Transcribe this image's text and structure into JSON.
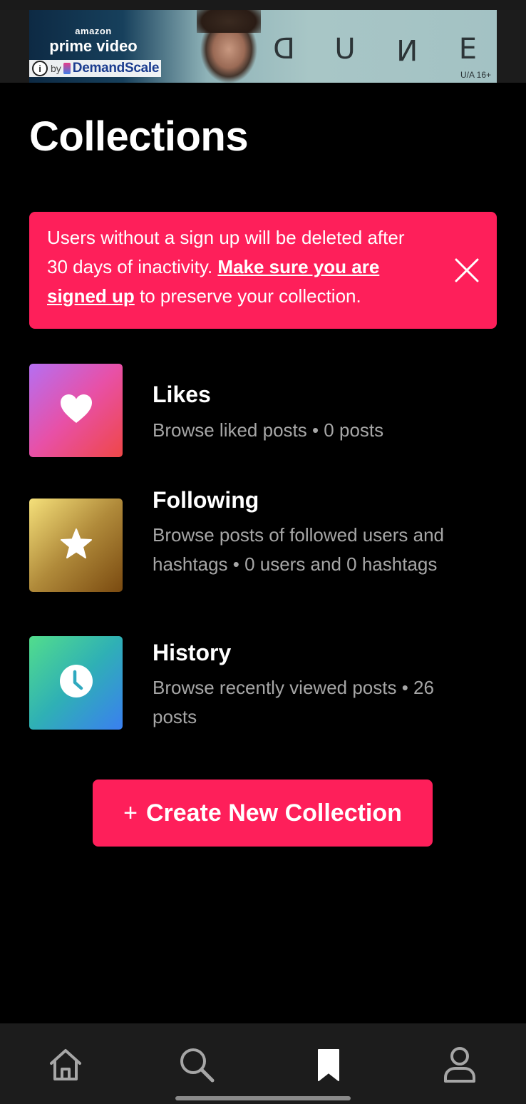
{
  "ad": {
    "brand_small": "amazon",
    "brand_main": "prime video",
    "attribution_by": "by",
    "attribution_name": "DemandScale",
    "info_glyph": "i",
    "movie_letters": [
      "D",
      "U",
      "N",
      "E"
    ],
    "rating": "U/A 16+"
  },
  "header": {
    "title": "Collections"
  },
  "notice": {
    "text_before": "Users without a sign up will be deleted after 30 days of inactivity. ",
    "link_text": "Make sure you are signed up",
    "text_after": " to preserve your collection.",
    "close_icon": "close-icon",
    "color": "#fe1f5a"
  },
  "collections": [
    {
      "title": "Likes",
      "description": "Browse liked posts • 0 posts",
      "icon": "heart-icon"
    },
    {
      "title": "Following",
      "description": "Browse posts of followed users and hashtags • 0 users and 0 hashtags",
      "icon": "star-icon"
    },
    {
      "title": "History",
      "description": "Browse recently viewed posts • 26 posts",
      "icon": "clock-icon"
    }
  ],
  "create_button": {
    "plus": "+",
    "label": "Create New Collection",
    "color": "#fe1f5a"
  },
  "bottom_nav": {
    "items": [
      {
        "name": "home",
        "icon": "home-icon",
        "active": false
      },
      {
        "name": "search",
        "icon": "search-icon",
        "active": false
      },
      {
        "name": "collections",
        "icon": "bookmark-icon",
        "active": true
      },
      {
        "name": "profile",
        "icon": "profile-icon",
        "active": false
      }
    ]
  }
}
